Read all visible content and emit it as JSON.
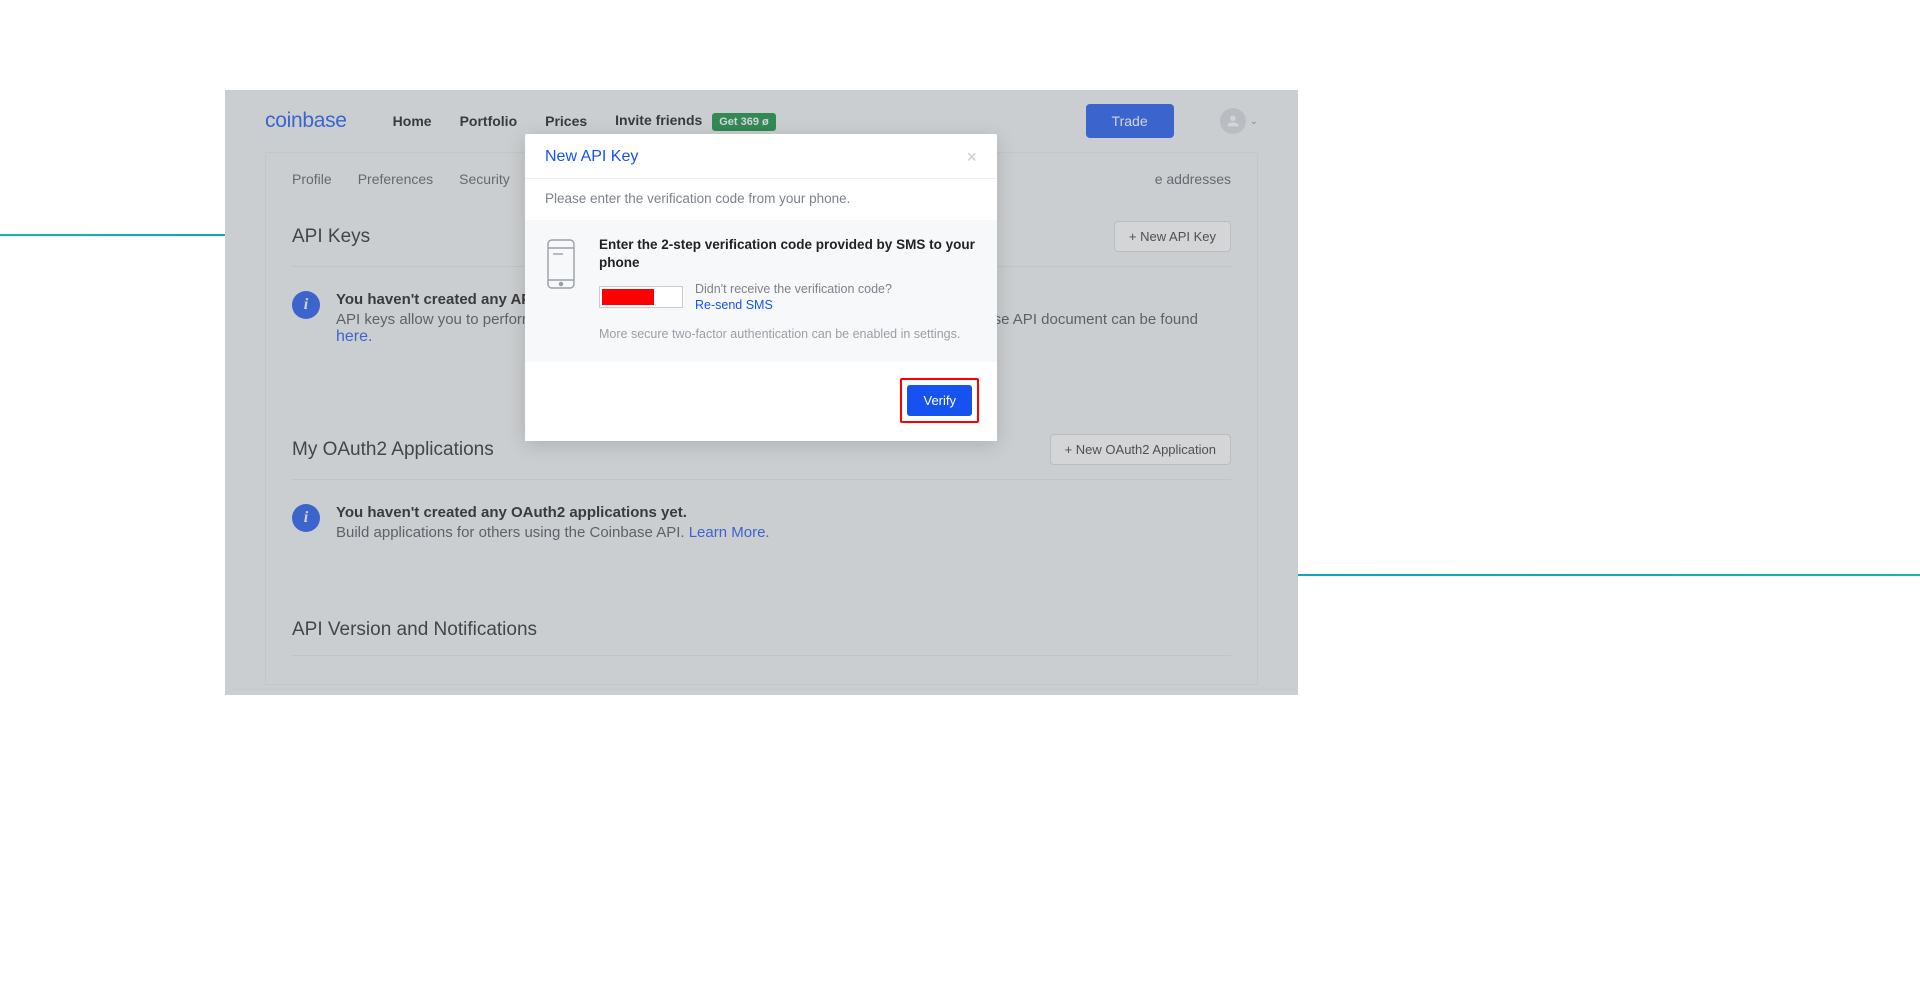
{
  "brand": {
    "name": "coinbase"
  },
  "nav": {
    "home": "Home",
    "portfolio": "Portfolio",
    "prices": "Prices",
    "invite": "Invite friends",
    "invite_badge": "Get 369 ø"
  },
  "header": {
    "trade": "Trade"
  },
  "tabs": {
    "profile": "Profile",
    "preferences": "Preferences",
    "security": "Security",
    "addresses_suffix": "e addresses"
  },
  "sections": {
    "api_keys": {
      "title": "API Keys",
      "new_btn": "+  New API Key",
      "info_bold_prefix": "You haven't created any API ",
      "info_sub_prefix": "API keys allow you to perform a",
      "info_sub_suffix": "ase API document can be found",
      "info_link": "here."
    },
    "oauth": {
      "title": "My OAuth2 Applications",
      "new_btn": "+  New OAuth2 Application",
      "info_bold": "You haven't created any OAuth2 applications yet.",
      "info_sub": "Build applications for others using the Coinbase API. ",
      "info_link": "Learn More."
    },
    "api_version": {
      "title": "API Version and Notifications"
    }
  },
  "modal": {
    "title": "New API Key",
    "instruction": "Please enter the verification code from your phone.",
    "lead": "Enter the 2-step verification code provided by SMS to your phone",
    "not_received": "Didn't receive the verification code?",
    "resend": "Re-send SMS",
    "footnote": "More secure two-factor authentication can be enabled in settings.",
    "verify": "Verify"
  }
}
